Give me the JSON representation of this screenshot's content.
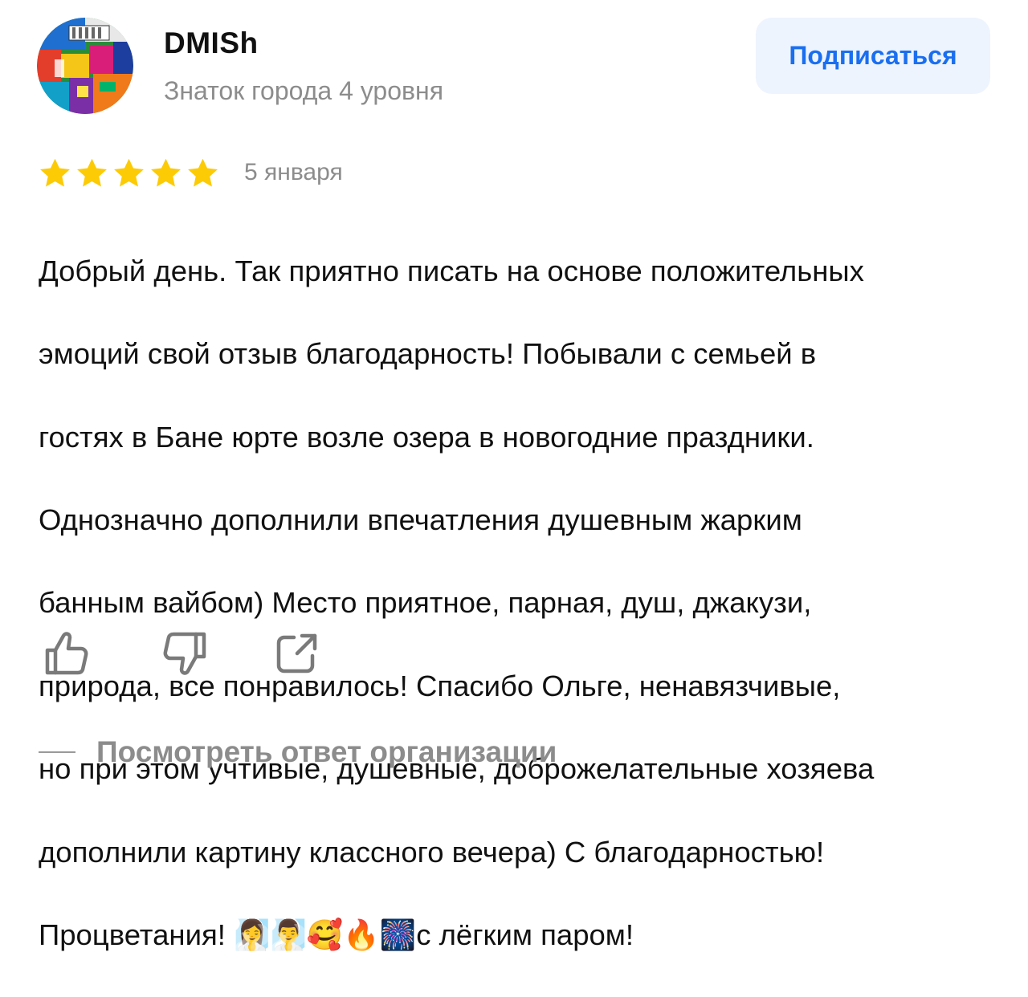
{
  "author": {
    "name": "DMISh",
    "level": "Знаток города 4 уровня",
    "avatar_icon": "colorful-mosaic-avatar"
  },
  "subscribe": {
    "label": "Подписаться",
    "color": "#1a6ff0",
    "background": "#eef4fd"
  },
  "review": {
    "rating": 5,
    "rating_max": 5,
    "star_color": "#fccb05",
    "date": "5 января",
    "lines": [
      "Добрый день. Так приятно писать на основе положительных",
      "эмоций свой отзыв благодарность! Побывали с семьей в",
      "гостях в Бане юрте возле озера в новогодние праздники.",
      "Однозначно дополнили впечатления душевным жарким",
      "банным вайбом) Место приятное, парная, душ, джакузи,",
      "природа, все понравилось! Спасибо Ольге, ненавязчивые,",
      "но при этом учтивые, душевные, доброжелательные хозяева",
      "дополнили картину классного вечера) С благодарностью!",
      "Процветания! 🧖‍♀️🧖‍♂️🥰🔥🎆с лёгким паром!"
    ]
  },
  "actions": {
    "like_icon": "thumbs-up-icon",
    "dislike_icon": "thumbs-down-icon",
    "share_icon": "share-icon"
  },
  "reply": {
    "label": "Посмотреть ответ организации"
  }
}
